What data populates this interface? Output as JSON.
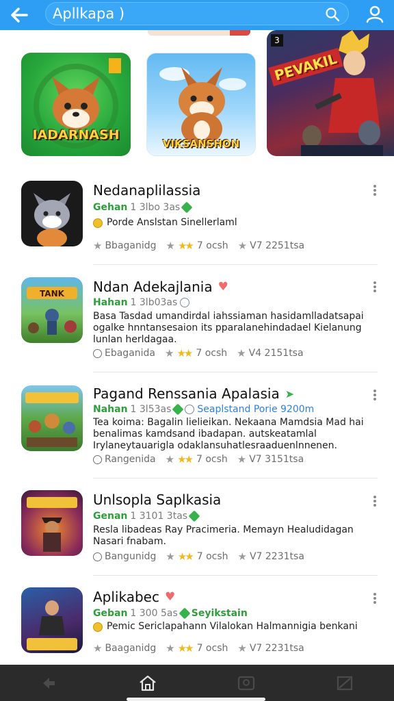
{
  "header": {
    "search_value": "Apllkapa )",
    "bar_color": "#2d9ef3"
  },
  "featured": [
    {
      "label": "IADARNASH",
      "icon": "fox-character-icon",
      "badge": "bookmark-icon"
    },
    {
      "label": "VIKSANSHON",
      "icon": "fox-character-icon"
    },
    {
      "label": "PEVAKIL",
      "badge": "3",
      "icon": "hero-character-icon"
    }
  ],
  "apps": [
    {
      "title": "Nedanaplilassia",
      "developer": "Gehan",
      "meta": "1 3lbo 3as",
      "description": "Porde Anslstan Sinellerlaml",
      "stats": {
        "category": "Bbaganidg",
        "rating": "7 ocsh",
        "version": "V7 2251tsa"
      }
    },
    {
      "title": "Ndan Adekajlania",
      "developer": "Hahan",
      "meta": "1 3lb03as",
      "description": "Basa Tasdad umandirdal iahssiaman hasidamlladatsapai ogalke hnntansesaion its pparalanehindadael Kielanung lunlan herldagaa.",
      "stats": {
        "category": "Ebaganida",
        "rating": "7 ocsh",
        "version": "V4 2151tsa"
      }
    },
    {
      "title": "Pagand Renssania Apalasia",
      "developer": "Nahan",
      "meta": "1 3l53as",
      "extra": "Seaplstand Porie 9200m",
      "description": "Tea koima: Bagalin lielieikan. Nekaana Mamdsia Mad hai benalimas kamdsand ibadapan. autskeatamlal Irylaneytauarigla odaklansuhatlesraaduenlnnenen.",
      "stats": {
        "category": "Rangenida",
        "rating": "7 ocsh",
        "version": "V7 3151tsa"
      }
    },
    {
      "title": "Unlsopla Saplkasia",
      "developer": "Genan",
      "meta": "1 3101 3tas",
      "description": "Resla libadeas Ray Pracimeria. Memayn Healudidagan Nasari fnabam.",
      "stats": {
        "category": "Bangunidg",
        "rating": "7 ocsh",
        "version": "V7 2231tsa"
      }
    },
    {
      "title": "Aplikabec",
      "developer": "Geban",
      "meta": "1 300 5as",
      "extra": "Seyikstain",
      "description": "Pemic Sericlapahann Vilalokan Halmannigia benkani",
      "stats": {
        "category": "Baaganidg",
        "rating": "7 ocsh",
        "version": "V7 2231tsa"
      }
    }
  ],
  "bottom_nav": [
    "back-icon",
    "home-icon",
    "store-icon",
    "menu-icon"
  ]
}
